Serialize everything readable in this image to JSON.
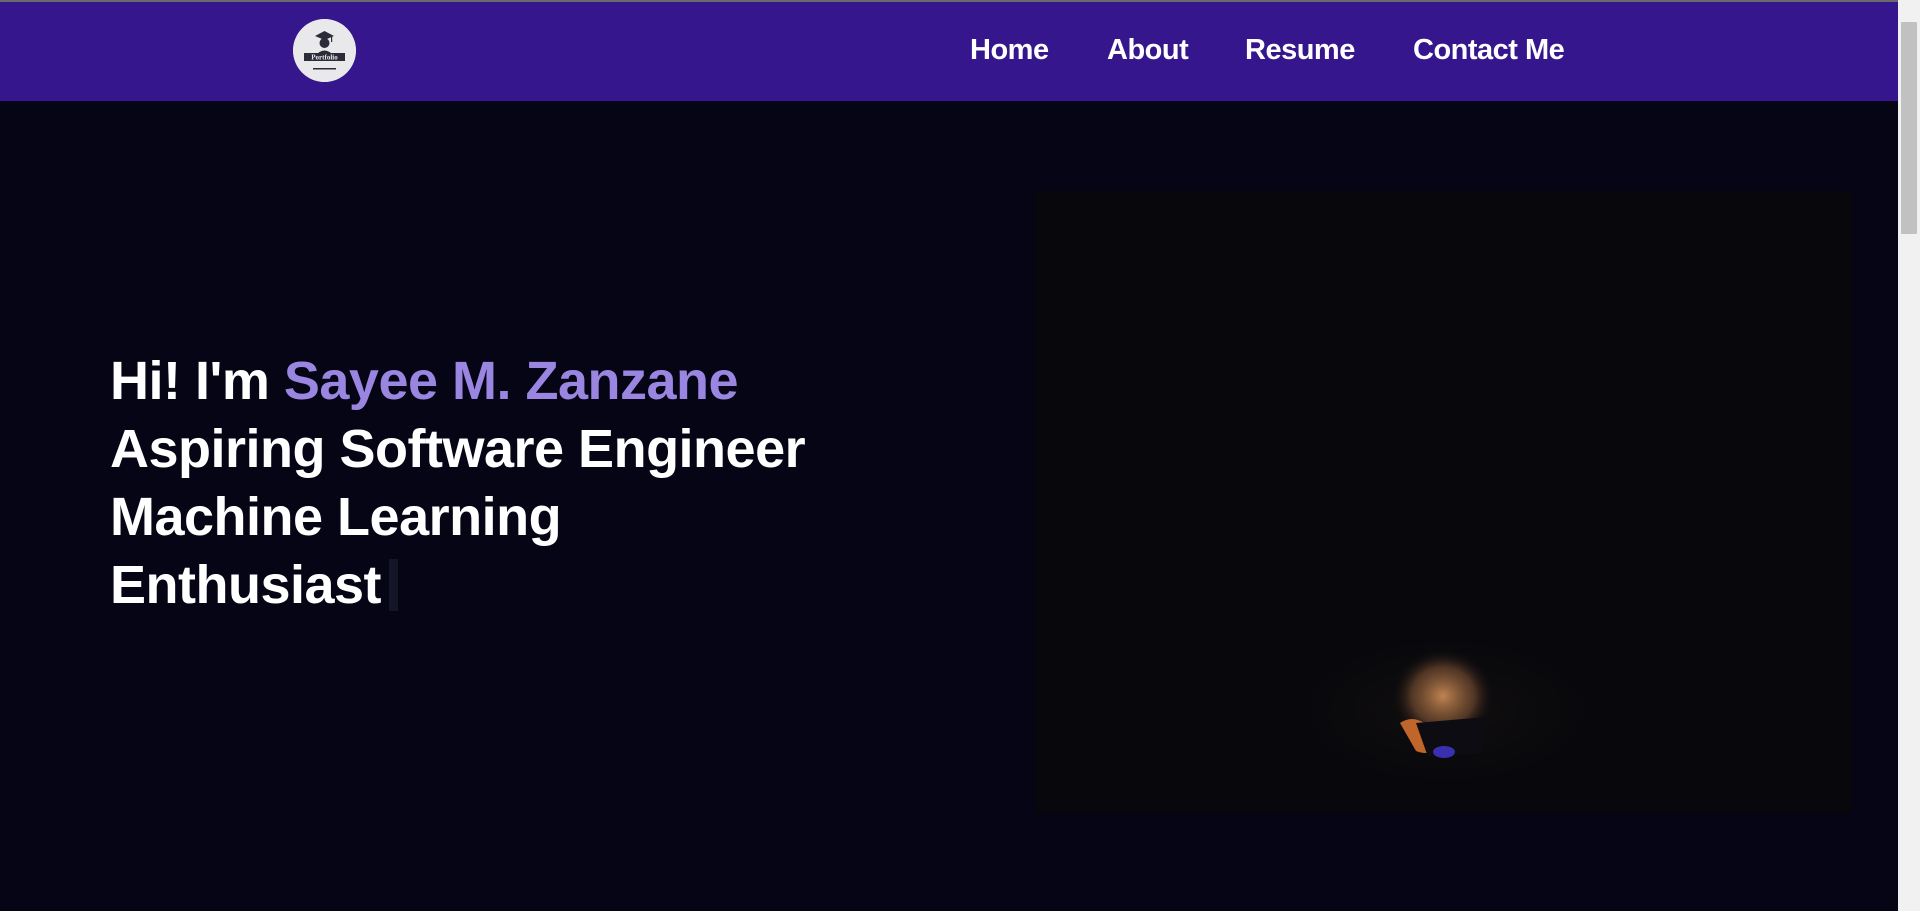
{
  "logo": {
    "text": "Portfolio"
  },
  "nav": {
    "items": [
      {
        "label": "Home"
      },
      {
        "label": "About"
      },
      {
        "label": "Resume"
      },
      {
        "label": "Contact Me"
      }
    ]
  },
  "hero": {
    "greeting_prefix": "Hi! I'm",
    "name": "Sayee M. Zanzane",
    "line2": "Aspiring Software Engineer",
    "line3": "Machine Learning",
    "line4": "Enthusiast"
  },
  "colors": {
    "navbar": "#36168c",
    "background": "#050515",
    "accent_name": "#9a86e0",
    "text": "#ffffff"
  },
  "icons": {
    "logo": "graduate-avatar-icon",
    "hero_image": "person-at-laptop-illustration"
  }
}
